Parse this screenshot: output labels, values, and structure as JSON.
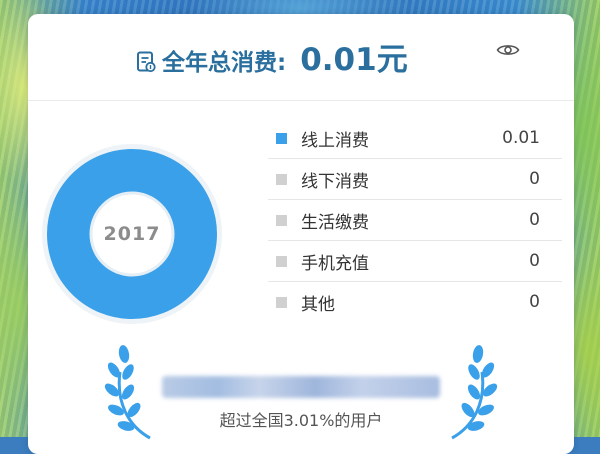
{
  "header": {
    "title_label": "全年总消费:",
    "title_value": "0.01元"
  },
  "donut": {
    "year": "2017",
    "color": "#3aa0e9"
  },
  "categories": [
    {
      "label": "线上消费",
      "value": "0.01",
      "color": "#3aa0e9"
    },
    {
      "label": "线下消费",
      "value": "0",
      "color": "#d0d0d0"
    },
    {
      "label": "生活缴费",
      "value": "0",
      "color": "#d0d0d0"
    },
    {
      "label": "手机充值",
      "value": "0",
      "color": "#d0d0d0"
    },
    {
      "label": "其他",
      "value": "0",
      "color": "#d0d0d0"
    }
  ],
  "ranking": {
    "text": "超过全国3.01%的用户"
  },
  "icons": {
    "bill": "bill-icon",
    "visibility": "eye-icon",
    "laurel": "laurel-icon"
  }
}
